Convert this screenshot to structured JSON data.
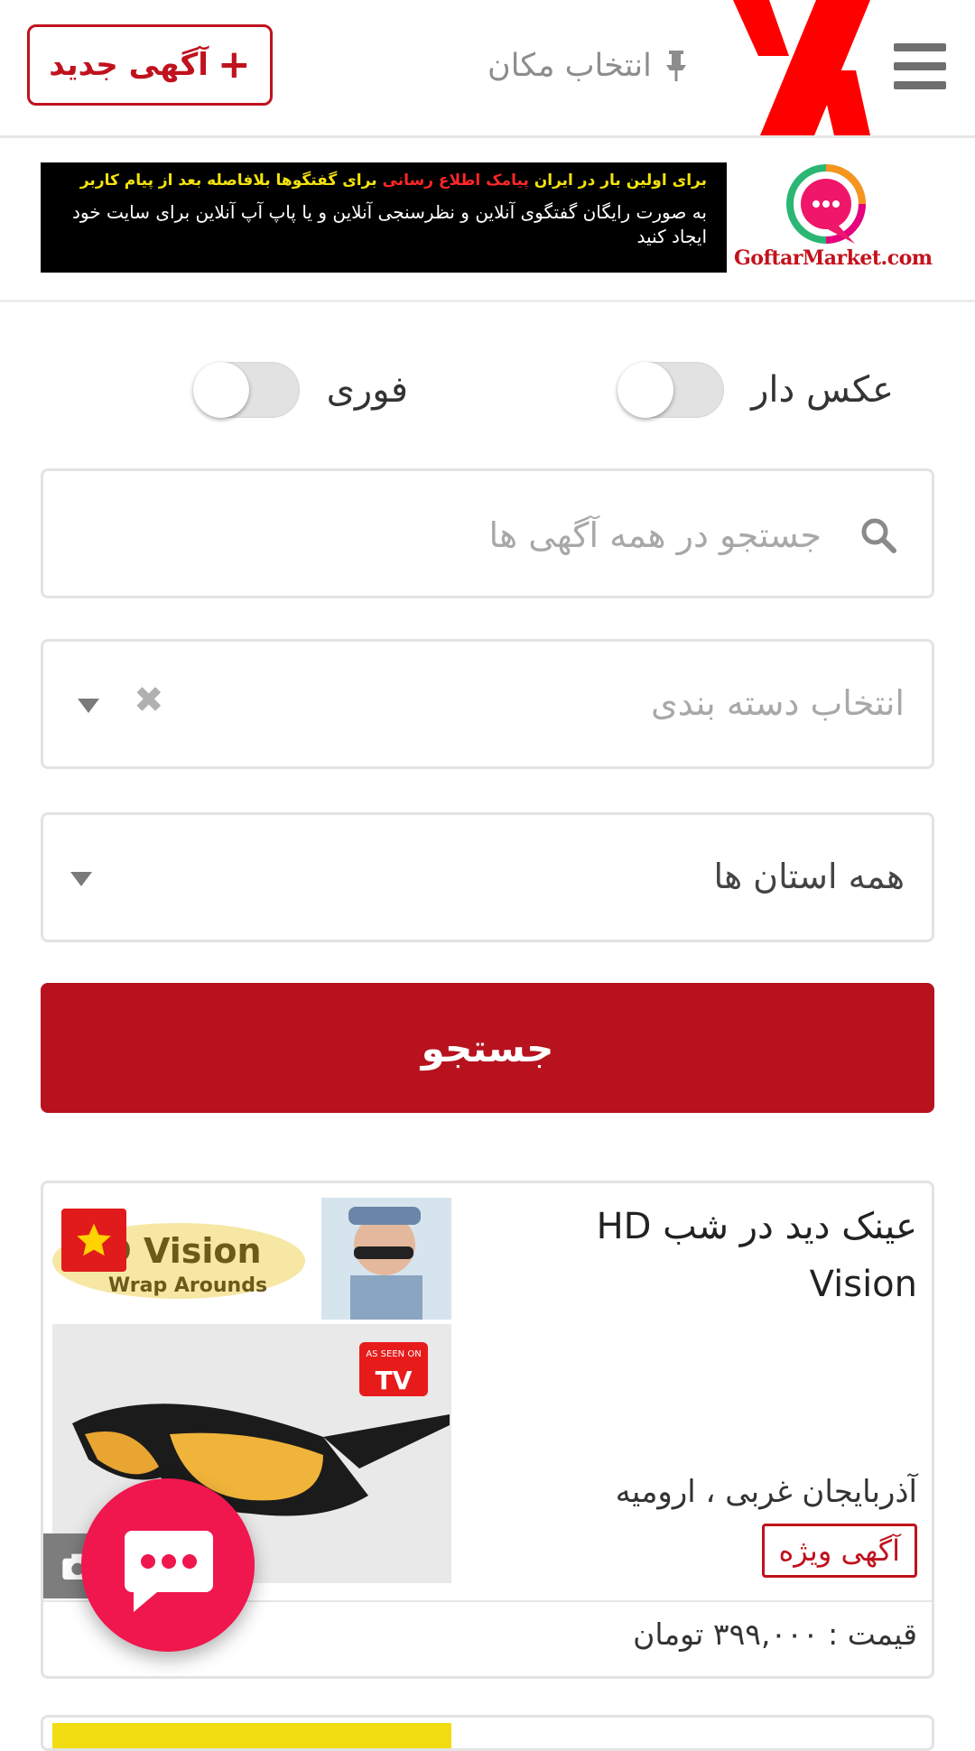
{
  "header": {
    "location_label": "انتخاب مکان",
    "new_ad_label": "آگهی جدید",
    "new_ad_plus": "+",
    "brand_color": "#c0121e"
  },
  "banner": {
    "logo_text": "GoftarMarket.com",
    "line1_start": "برای اولین بار در ایران ",
    "line1_highlight": "پیامک اطلاع رسانی",
    "line1_end": " برای گفتگوها بلافاصله بعد از پیام کاربر",
    "line2": "به صورت رایگان گفتگوی آنلاین و نظرسنجی آنلاین و یا پاپ آپ آنلاین برای سایت خود ایجاد کنید"
  },
  "filters": {
    "has_photo_label": "عکس دار",
    "has_photo_on": false,
    "urgent_label": "فوری",
    "urgent_on": false
  },
  "search": {
    "placeholder": "جستجو در همه آگهی ها",
    "category_placeholder": "انتخاب دسته بندی",
    "category_clear": "✖",
    "province_value": "همه استان ها",
    "submit_label": "جستجو",
    "submit_color": "#b7121e"
  },
  "listing": {
    "title": "عینک دید در شب HD Vision",
    "image_text_1": "HD Vision",
    "image_text_2": "Wrap Arounds",
    "image_tv_1": "AS SEEN ON",
    "image_tv_2": "TV",
    "location": "آذربایجان غربی ، ارومیه",
    "badge": "آگهی ویژه",
    "price": "قیمت : ۳۹۹,۰۰۰ تومان"
  },
  "chat": {
    "color": "#f0164e"
  }
}
